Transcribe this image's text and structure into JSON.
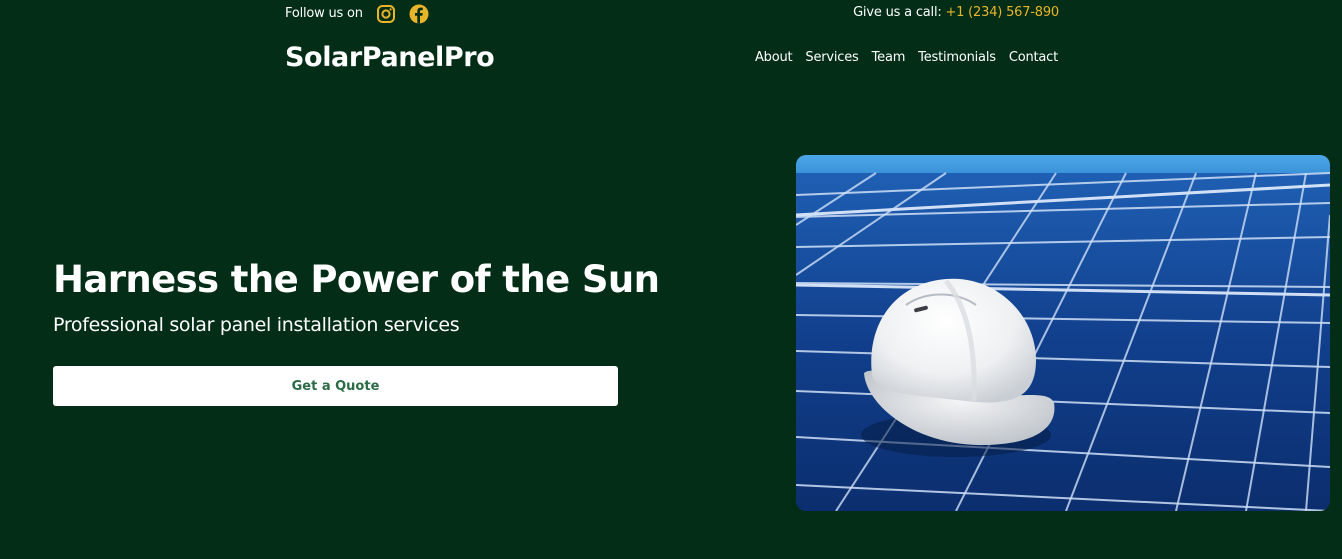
{
  "topbar": {
    "follow_text": "Follow us on",
    "social": [
      {
        "icon": "instagram-icon",
        "color": "#e8b42a"
      },
      {
        "icon": "facebook-icon",
        "color": "#e8b42a"
      }
    ],
    "call_label": "Give us a call:",
    "phone": "+1 (234) 567-890"
  },
  "header": {
    "logo": "SolarPanelPro",
    "nav": [
      "About",
      "Services",
      "Team",
      "Testimonials",
      "Contact"
    ]
  },
  "hero": {
    "title": "Harness the Power of the Sun",
    "subtitle": "Professional solar panel installation services",
    "cta_label": "Get a Quote",
    "image_subject": "white hard hat on solar panels"
  },
  "colors": {
    "background": "#032d17",
    "accent": "#e8b42a",
    "button_text": "#2c6b45",
    "text": "#ffffff"
  }
}
